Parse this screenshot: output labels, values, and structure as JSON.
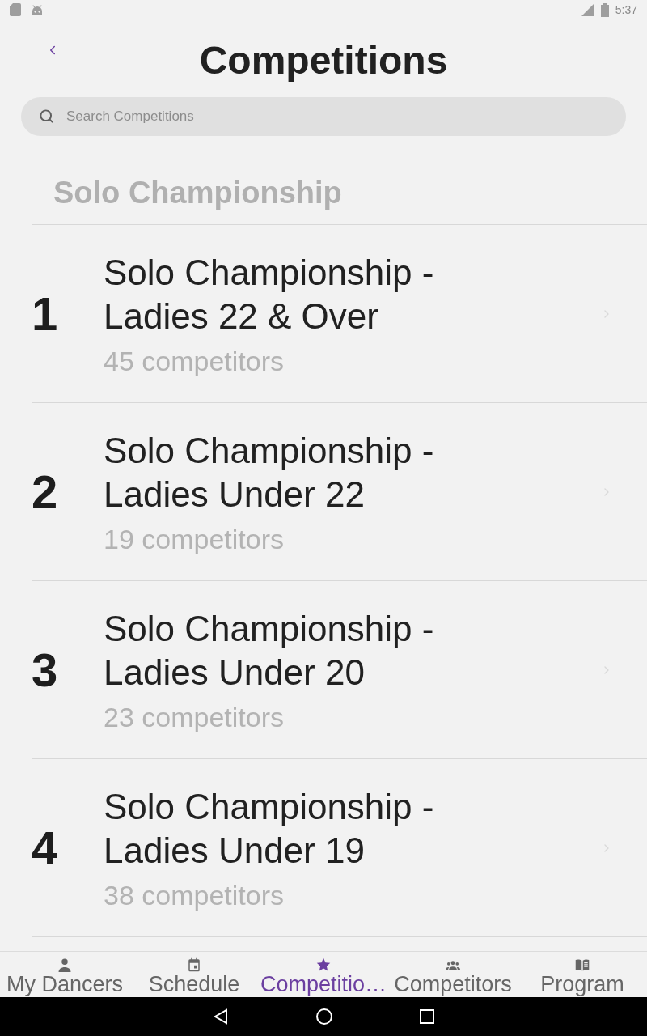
{
  "status_bar": {
    "time": "5:37"
  },
  "header": {
    "title": "Competitions"
  },
  "search": {
    "placeholder": "Search Competitions"
  },
  "sections": [
    {
      "title": "Solo Championship",
      "items": [
        {
          "number": "1",
          "title": "Solo Championship - Ladies 22 & Over",
          "subtitle": "45 competitors"
        },
        {
          "number": "2",
          "title": "Solo Championship - Ladies Under 22",
          "subtitle": "19 competitors"
        },
        {
          "number": "3",
          "title": "Solo Championship - Ladies Under 20",
          "subtitle": "23 competitors"
        },
        {
          "number": "4",
          "title": "Solo Championship - Ladies Under 19",
          "subtitle": "38 competitors"
        }
      ]
    }
  ],
  "tabs": [
    {
      "label": "My Dancers",
      "selected": false
    },
    {
      "label": "Schedule",
      "selected": false
    },
    {
      "label": "Competitio…",
      "selected": true
    },
    {
      "label": "Competitors",
      "selected": false
    },
    {
      "label": "Program",
      "selected": false
    }
  ]
}
